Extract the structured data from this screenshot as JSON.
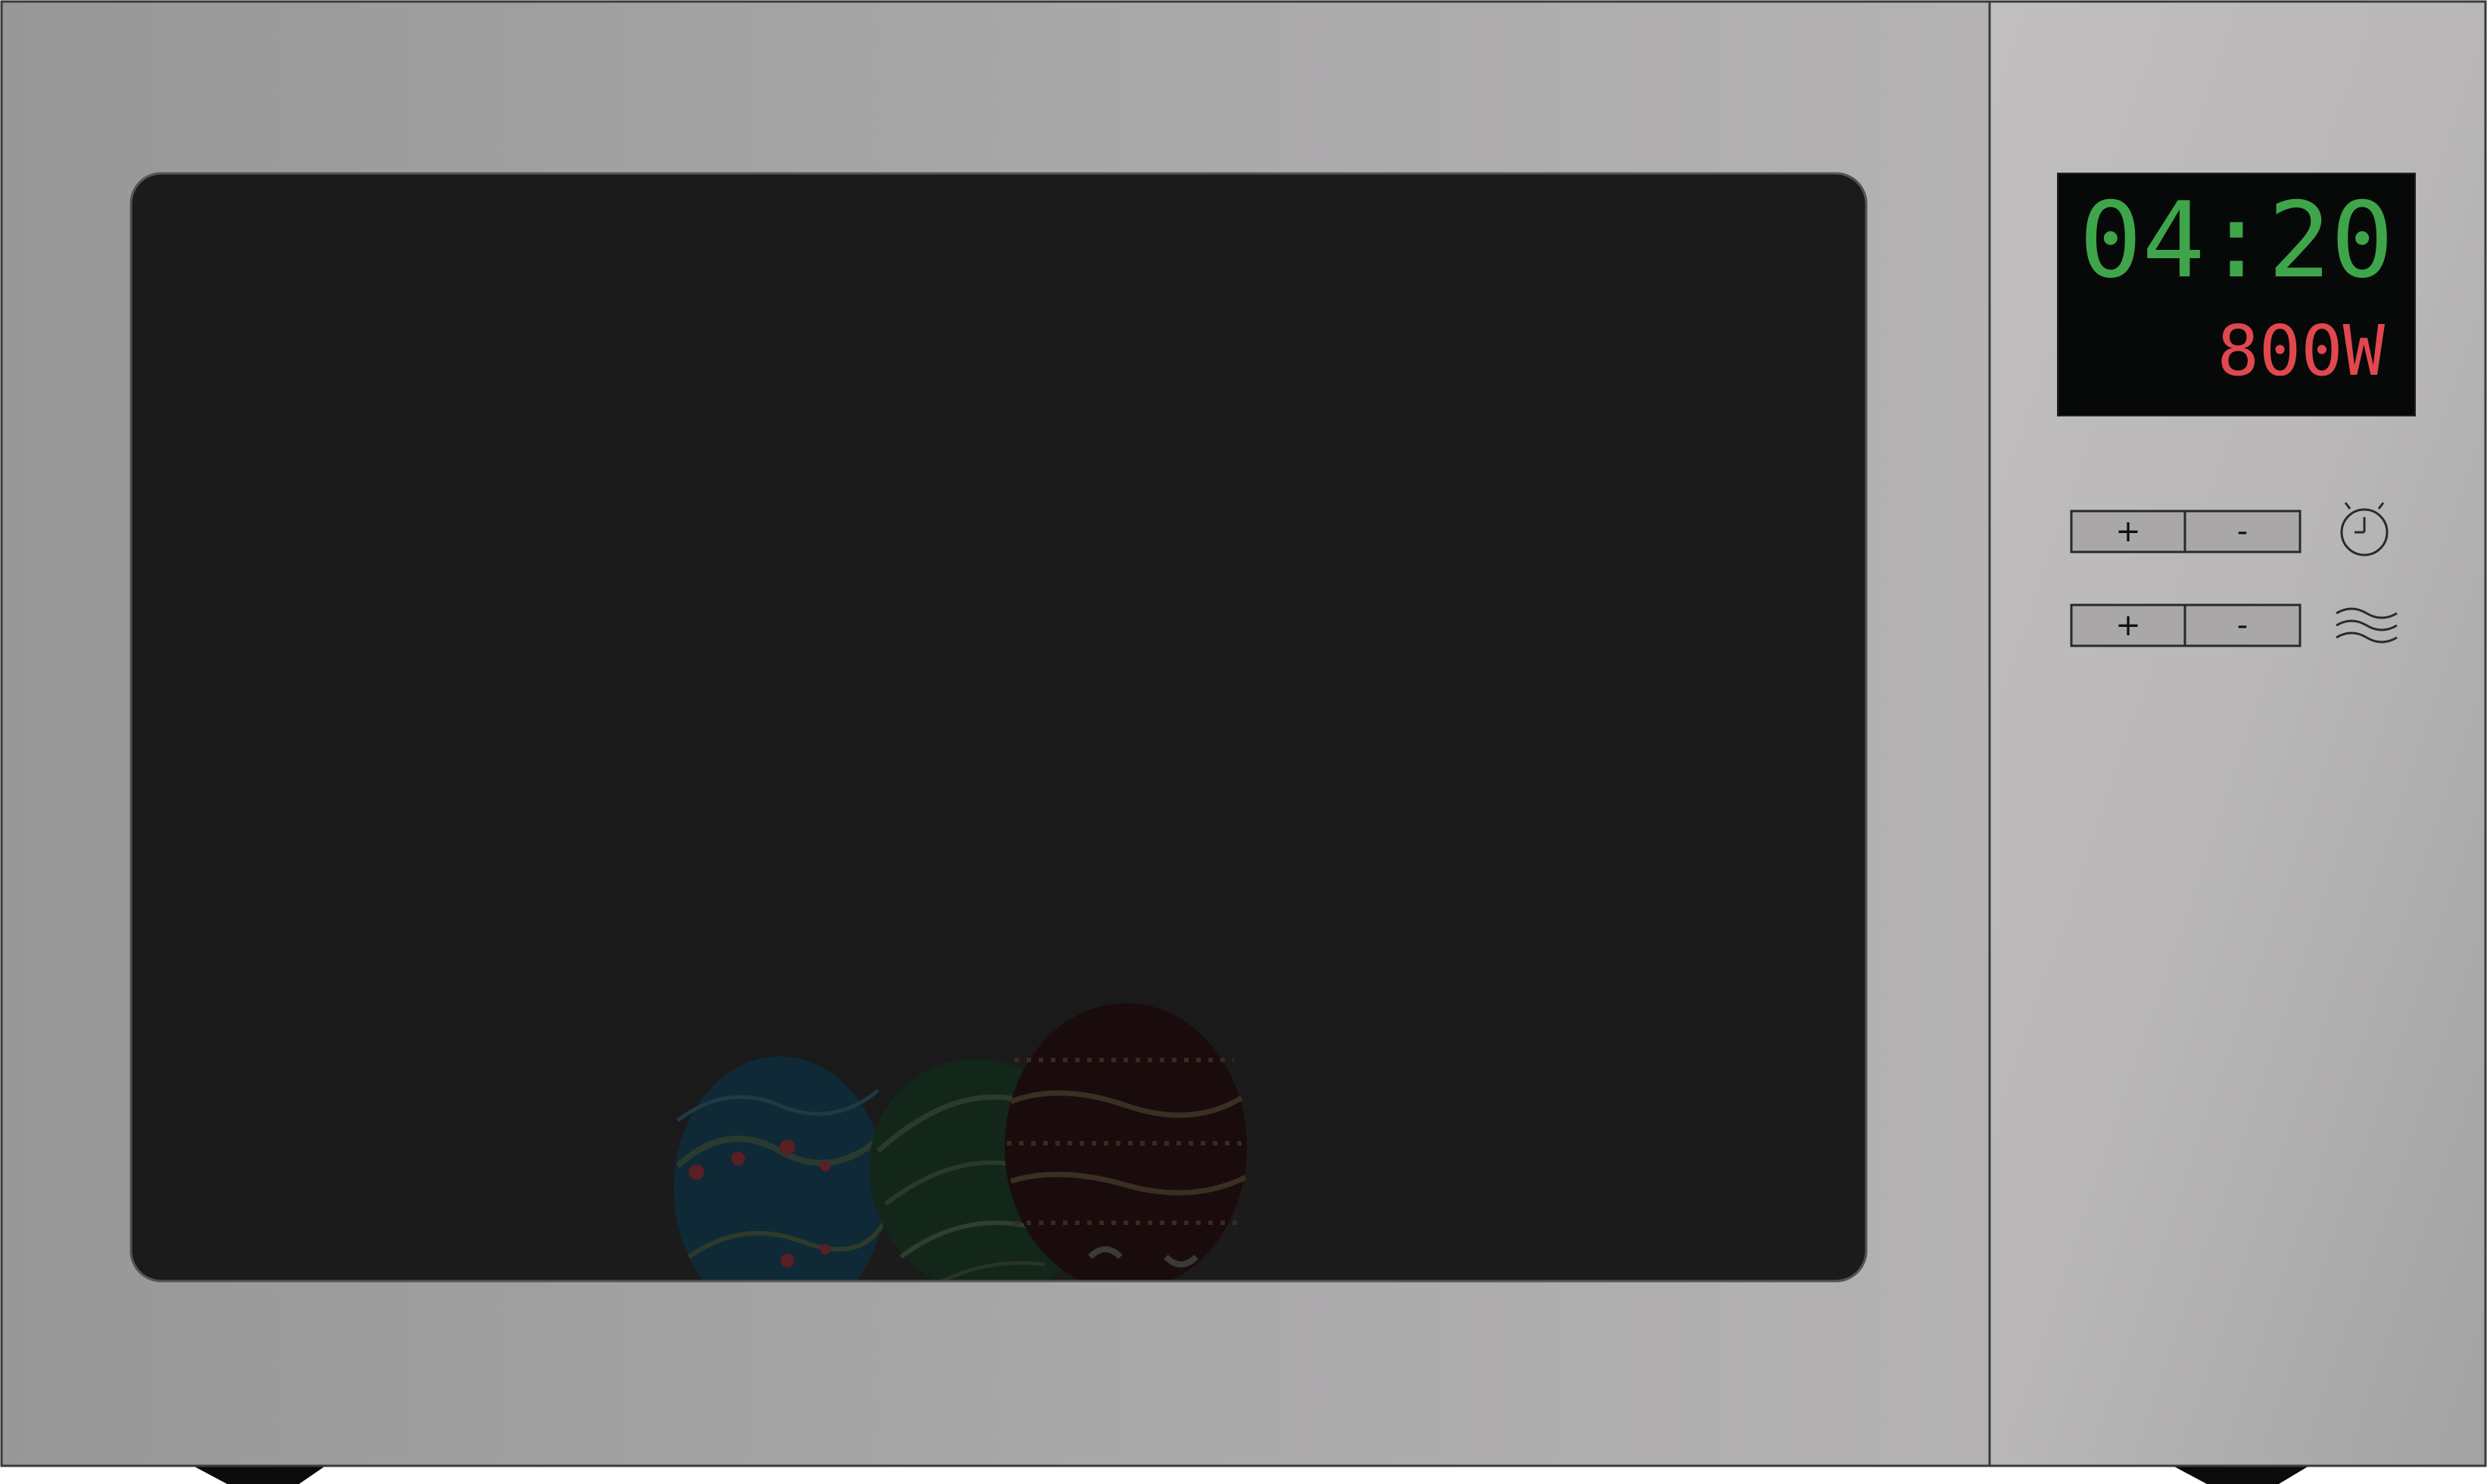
{
  "display": {
    "time": "04:20",
    "power": "800W",
    "time_color": "#3fa54a",
    "power_color": "#e0484e",
    "background": "#070909"
  },
  "controls": {
    "timer_row": {
      "icon": "stopwatch-icon",
      "plus_label": "+",
      "minus_label": "-"
    },
    "power_row": {
      "icon": "microwave-waves-icon",
      "plus_label": "+",
      "minus_label": "-"
    }
  },
  "body": {
    "colors": {
      "steel_dark": "#989898",
      "steel_light": "#b3b1b2",
      "window": "#1b1b1b",
      "feet": "#0b0b0b"
    }
  },
  "contents": {
    "items": [
      {
        "name": "blue-easter-egg",
        "color": "#0f2a36"
      },
      {
        "name": "green-easter-egg",
        "color": "#13261a"
      },
      {
        "name": "brown-easter-egg",
        "color": "#1a0c0d"
      }
    ]
  }
}
